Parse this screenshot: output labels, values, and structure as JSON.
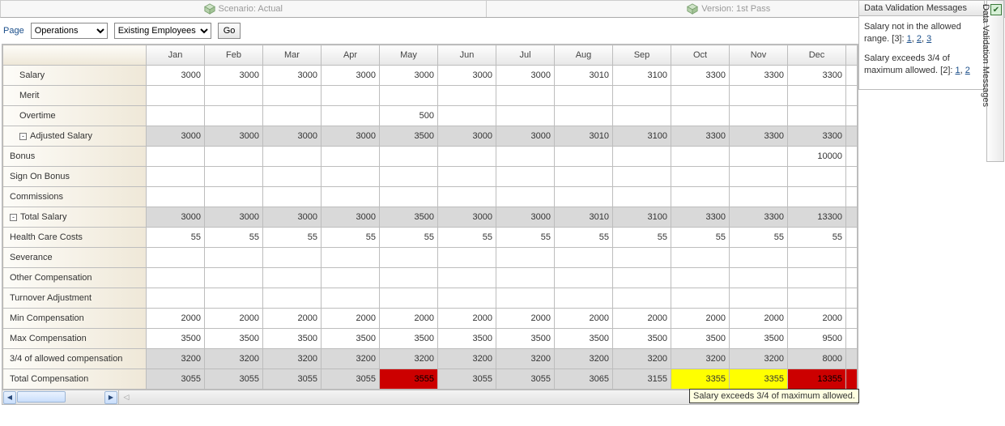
{
  "topbar": {
    "scenario_label": "Scenario: Actual",
    "version_label": "Version: 1st Pass"
  },
  "pagebar": {
    "label": "Page",
    "dim1_value": "Operations",
    "dim2_value": "Existing Employees",
    "go_label": "Go"
  },
  "columns": [
    "Jan",
    "Feb",
    "Mar",
    "Apr",
    "May",
    "Jun",
    "Jul",
    "Aug",
    "Sep",
    "Oct",
    "Nov",
    "Dec"
  ],
  "rows": [
    {
      "label": "Salary",
      "indent": 1,
      "shaded": false,
      "expander": null,
      "values": [
        "3000",
        "3000",
        "3000",
        "3000",
        "3000",
        "3000",
        "3000",
        "3010",
        "3100",
        "3300",
        "3300",
        "3300"
      ]
    },
    {
      "label": "Merit",
      "indent": 1,
      "shaded": false,
      "expander": null,
      "values": [
        "",
        "",
        "",
        "",
        "",
        "",
        "",
        "",
        "",
        "",
        "",
        ""
      ]
    },
    {
      "label": "Overtime",
      "indent": 1,
      "shaded": false,
      "expander": null,
      "values": [
        "",
        "",
        "",
        "",
        "500",
        "",
        "",
        "",
        "",
        "",
        "",
        ""
      ]
    },
    {
      "label": "Adjusted Salary",
      "indent": 1,
      "shaded": true,
      "expander": "-",
      "values": [
        "3000",
        "3000",
        "3000",
        "3000",
        "3500",
        "3000",
        "3000",
        "3010",
        "3100",
        "3300",
        "3300",
        "3300"
      ]
    },
    {
      "label": "Bonus",
      "indent": 0,
      "shaded": false,
      "expander": null,
      "values": [
        "",
        "",
        "",
        "",
        "",
        "",
        "",
        "",
        "",
        "",
        "",
        "10000"
      ]
    },
    {
      "label": "Sign On Bonus",
      "indent": 0,
      "shaded": false,
      "expander": null,
      "values": [
        "",
        "",
        "",
        "",
        "",
        "",
        "",
        "",
        "",
        "",
        "",
        ""
      ]
    },
    {
      "label": "Commissions",
      "indent": 0,
      "shaded": false,
      "expander": null,
      "values": [
        "",
        "",
        "",
        "",
        "",
        "",
        "",
        "",
        "",
        "",
        "",
        ""
      ]
    },
    {
      "label": "Total Salary",
      "indent": 0,
      "shaded": true,
      "expander": "-",
      "values": [
        "3000",
        "3000",
        "3000",
        "3000",
        "3500",
        "3000",
        "3000",
        "3010",
        "3100",
        "3300",
        "3300",
        "13300"
      ]
    },
    {
      "label": "Health Care Costs",
      "indent": 0,
      "shaded": false,
      "expander": null,
      "values": [
        "55",
        "55",
        "55",
        "55",
        "55",
        "55",
        "55",
        "55",
        "55",
        "55",
        "55",
        "55"
      ]
    },
    {
      "label": "Severance",
      "indent": 0,
      "shaded": false,
      "expander": null,
      "values": [
        "",
        "",
        "",
        "",
        "",
        "",
        "",
        "",
        "",
        "",
        "",
        ""
      ]
    },
    {
      "label": "Other Compensation",
      "indent": 0,
      "shaded": false,
      "expander": null,
      "values": [
        "",
        "",
        "",
        "",
        "",
        "",
        "",
        "",
        "",
        "",
        "",
        ""
      ]
    },
    {
      "label": "Turnover Adjustment",
      "indent": 0,
      "shaded": false,
      "expander": null,
      "values": [
        "",
        "",
        "",
        "",
        "",
        "",
        "",
        "",
        "",
        "",
        "",
        ""
      ]
    },
    {
      "label": "Min Compensation",
      "indent": 0,
      "shaded": false,
      "expander": null,
      "values": [
        "2000",
        "2000",
        "2000",
        "2000",
        "2000",
        "2000",
        "2000",
        "2000",
        "2000",
        "2000",
        "2000",
        "2000"
      ]
    },
    {
      "label": "Max Compensation",
      "indent": 0,
      "shaded": false,
      "expander": null,
      "values": [
        "3500",
        "3500",
        "3500",
        "3500",
        "3500",
        "3500",
        "3500",
        "3500",
        "3500",
        "3500",
        "3500",
        "9500"
      ]
    },
    {
      "label": "3/4 of allowed compensation",
      "indent": 0,
      "shaded": true,
      "expander": null,
      "values": [
        "3200",
        "3200",
        "3200",
        "3200",
        "3200",
        "3200",
        "3200",
        "3200",
        "3200",
        "3200",
        "3200",
        "8000"
      ]
    },
    {
      "label": "Total Compensation",
      "indent": 0,
      "shaded": true,
      "expander": null,
      "values": [
        "3055",
        "3055",
        "3055",
        "3055",
        "3555",
        "3055",
        "3055",
        "3065",
        "3155",
        "3355",
        "3355",
        "13355"
      ],
      "highlights": {
        "4": "red",
        "9": "yellow",
        "10": "yellow",
        "11": "red",
        "stub": "red"
      }
    }
  ],
  "tooltip": "Salary exceeds 3/4 of maximum allowed.",
  "validation": {
    "title": "Data Validation Messages",
    "msgs": [
      {
        "text": "Salary not in the allowed range.",
        "count": "[3]",
        "links": [
          "1",
          "2",
          "3"
        ]
      },
      {
        "text": "Salary exceeds 3/4 of maximum allowed.",
        "count": "[2]",
        "links": [
          "1",
          "2"
        ]
      }
    ]
  },
  "collapsed_tab": "Data Validation Messages"
}
